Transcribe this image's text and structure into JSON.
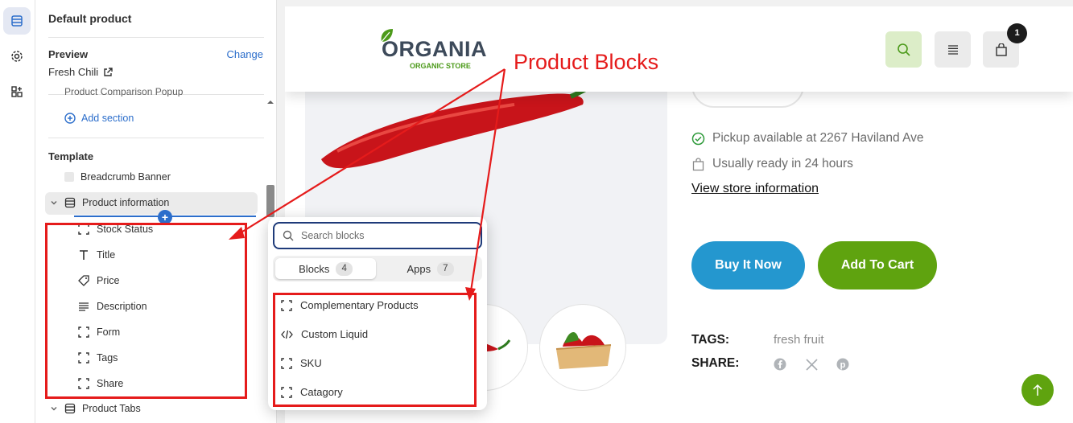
{
  "sidebar": {
    "title": "Default product",
    "preview_label": "Preview",
    "preview_change": "Change",
    "preview_value": "Fresh Chili",
    "cut_item": "Product Comparison Popup",
    "add_section": "Add section",
    "template_label": "Template",
    "template_items": [
      "Breadcrumb Banner",
      "Product information",
      "Product Tabs"
    ],
    "blocks": [
      "Stock Status",
      "Title",
      "Price",
      "Description",
      "Form",
      "Tags",
      "Share"
    ]
  },
  "store": {
    "logo": "ORGANIA",
    "logo_sub": "ORGANIC STORE",
    "cart_count": "1",
    "pickup": "Pickup available at 2267 Haviland Ave",
    "ready": "Usually ready in 24 hours",
    "store_link": "View store information",
    "buy_now": "Buy It Now",
    "add_to_cart": "Add To Cart",
    "tags_label": "TAGS:",
    "tags_value": "fresh fruit",
    "share_label": "SHARE:"
  },
  "popover": {
    "search_placeholder": "Search blocks",
    "tabs": [
      {
        "label": "Blocks",
        "count": "4"
      },
      {
        "label": "Apps",
        "count": "7"
      }
    ],
    "items": [
      "Complementary Products",
      "Custom Liquid",
      "SKU",
      "Catagory"
    ]
  },
  "annotation": {
    "title": "Product Blocks"
  },
  "colors": {
    "annotation_red": "#e51b1b",
    "accent_blue": "#2c6ecb",
    "buy_blue": "#2497cf",
    "brand_green": "#5fa30f"
  }
}
